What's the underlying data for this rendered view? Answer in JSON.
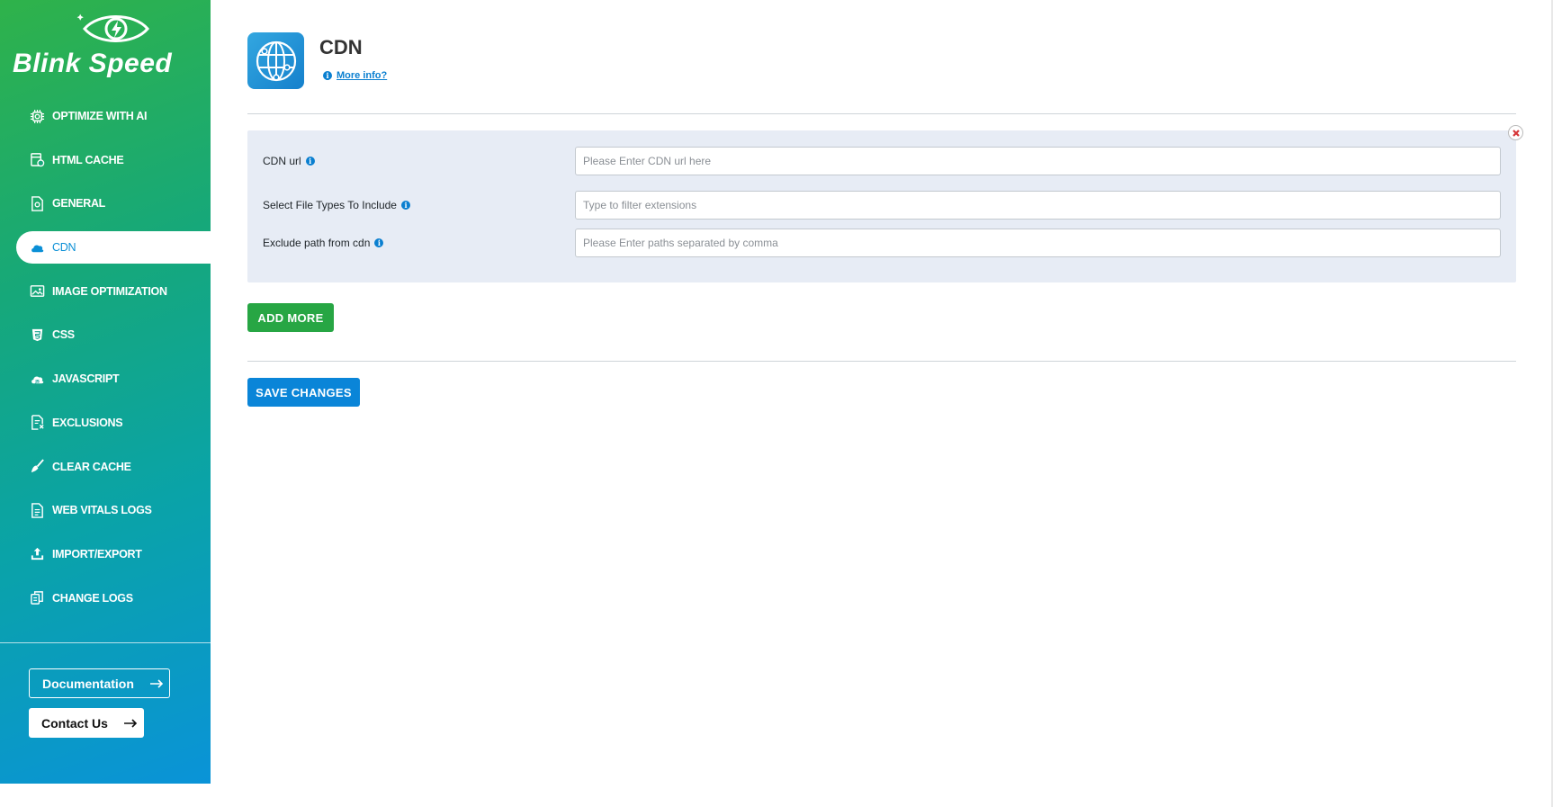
{
  "brand": {
    "logo_text": "Blink Speed",
    "gradient": [
      "#2fb24a",
      "#0aa3a8",
      "#0a93d8"
    ]
  },
  "sidebar": {
    "items": [
      {
        "label": "OPTIMIZE WITH AI",
        "icon": "ai-chip-icon"
      },
      {
        "label": "HTML CACHE",
        "icon": "html-cache-icon"
      },
      {
        "label": "GENERAL",
        "icon": "settings-document-icon"
      },
      {
        "label": "CDN",
        "icon": "cloud-icon",
        "active": true
      },
      {
        "label": "IMAGE OPTIMIZATION",
        "icon": "image-icon"
      },
      {
        "label": "CSS",
        "icon": "css3-icon"
      },
      {
        "label": "JAVASCRIPT",
        "icon": "javascript-cloud-icon"
      },
      {
        "label": "EXCLUSIONS",
        "icon": "exclusion-document-icon"
      },
      {
        "label": "CLEAR CACHE",
        "icon": "broom-icon"
      },
      {
        "label": "WEB VITALS LOGS",
        "icon": "log-document-icon"
      },
      {
        "label": "IMPORT/EXPORT",
        "icon": "upload-icon"
      },
      {
        "label": "CHANGE LOGS",
        "icon": "change-log-icon"
      }
    ],
    "documentation_label": "Documentation",
    "contact_label": "Contact Us"
  },
  "page": {
    "title": "CDN",
    "more_info": "More info?",
    "icon": "globe-icon"
  },
  "cdn_form": {
    "fields": [
      {
        "label": "CDN url",
        "value": "",
        "placeholder": "Please Enter CDN url here"
      },
      {
        "label": "Select File Types To Include",
        "value": "",
        "placeholder": "Type to filter extensions"
      },
      {
        "label": "Exclude path from cdn",
        "value": "",
        "placeholder": "Please Enter paths separated by comma"
      }
    ]
  },
  "actions": {
    "add_more": "ADD MORE",
    "save_changes": "SAVE CHANGES"
  },
  "colors": {
    "accent_blue": "#0a85d8",
    "accent_green": "#27a644",
    "panel_bg": "#e7ecf5",
    "remove_red": "#d63638"
  }
}
